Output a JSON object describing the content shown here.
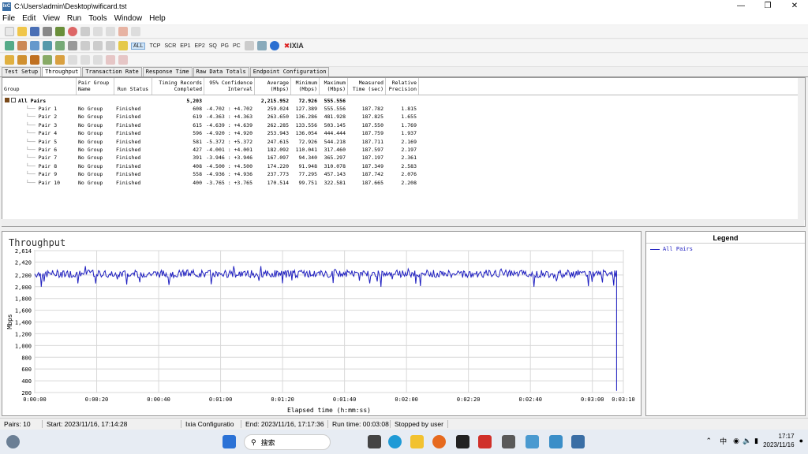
{
  "window": {
    "title": "C:\\Users\\admin\\Desktop\\wificard.tst",
    "app_icon": "IxC"
  },
  "menu": [
    "File",
    "Edit",
    "View",
    "Run",
    "Tools",
    "Window",
    "Help"
  ],
  "toolbar2": {
    "items": [
      "ALL",
      "TCP",
      "SCR",
      "EP1",
      "EP2",
      "SQ",
      "PG",
      "PC"
    ],
    "brand": "IXIA"
  },
  "tabs": [
    "Test Setup",
    "Throughput",
    "Transaction Rate",
    "Response Time",
    "Raw Data Totals",
    "Endpoint Configuration"
  ],
  "grid": {
    "headers": [
      "Group",
      "Pair Group Name",
      "Run Status",
      "Timing Records Completed",
      "95% Confidence Interval",
      "Average (Mbps)",
      "Minimum (Mbps)",
      "Maximum (Mbps)",
      "Measured Time (sec)",
      "Relative Precision"
    ],
    "summary": {
      "label": "All Pairs",
      "records": "5,203",
      "average": "2,215.952",
      "minimum": "72.926",
      "maximum": "555.556"
    },
    "rows": [
      {
        "pair": "Pair 1",
        "group": "No Group",
        "status": "Finished",
        "records": "608",
        "ci": "-4.702 : +4.702",
        "avg": "259.024",
        "min": "127.389",
        "max": "555.556",
        "time": "187.782",
        "prec": "1.815"
      },
      {
        "pair": "Pair 2",
        "group": "No Group",
        "status": "Finished",
        "records": "619",
        "ci": "-4.363 : +4.363",
        "avg": "263.650",
        "min": "136.286",
        "max": "481.928",
        "time": "187.825",
        "prec": "1.655"
      },
      {
        "pair": "Pair 3",
        "group": "No Group",
        "status": "Finished",
        "records": "615",
        "ci": "-4.639 : +4.639",
        "avg": "262.285",
        "min": "133.556",
        "max": "503.145",
        "time": "187.550",
        "prec": "1.769"
      },
      {
        "pair": "Pair 4",
        "group": "No Group",
        "status": "Finished",
        "records": "596",
        "ci": "-4.920 : +4.920",
        "avg": "253.943",
        "min": "136.054",
        "max": "444.444",
        "time": "187.759",
        "prec": "1.937"
      },
      {
        "pair": "Pair 5",
        "group": "No Group",
        "status": "Finished",
        "records": "581",
        "ci": "-5.372 : +5.372",
        "avg": "247.615",
        "min": "72.926",
        "max": "544.218",
        "time": "187.711",
        "prec": "2.169"
      },
      {
        "pair": "Pair 6",
        "group": "No Group",
        "status": "Finished",
        "records": "427",
        "ci": "-4.001 : +4.001",
        "avg": "182.092",
        "min": "110.041",
        "max": "317.460",
        "time": "187.597",
        "prec": "2.197"
      },
      {
        "pair": "Pair 7",
        "group": "No Group",
        "status": "Finished",
        "records": "391",
        "ci": "-3.946 : +3.946",
        "avg": "167.097",
        "min": "94.340",
        "max": "365.297",
        "time": "187.197",
        "prec": "2.361"
      },
      {
        "pair": "Pair 8",
        "group": "No Group",
        "status": "Finished",
        "records": "408",
        "ci": "-4.500 : +4.500",
        "avg": "174.220",
        "min": "91.948",
        "max": "310.078",
        "time": "187.349",
        "prec": "2.583"
      },
      {
        "pair": "Pair 9",
        "group": "No Group",
        "status": "Finished",
        "records": "558",
        "ci": "-4.936 : +4.936",
        "avg": "237.773",
        "min": "77.295",
        "max": "457.143",
        "time": "187.742",
        "prec": "2.076"
      },
      {
        "pair": "Pair 10",
        "group": "No Group",
        "status": "Finished",
        "records": "400",
        "ci": "-3.765 : +3.765",
        "avg": "170.514",
        "min": "99.751",
        "max": "322.581",
        "time": "187.665",
        "prec": "2.208"
      }
    ]
  },
  "chart_data": {
    "type": "line",
    "title": "Throughput",
    "xlabel": "Elapsed time (h:mm:ss)",
    "ylabel": "Mbps",
    "ylim": [
      200,
      2614
    ],
    "yticks": [
      "2,614",
      "2,420",
      "2,200",
      "2,000",
      "1,800",
      "1,600",
      "1,400",
      "1,200",
      "1,000",
      "800",
      "600",
      "400",
      "200"
    ],
    "xticks": [
      "0:00:00",
      "0:00:20",
      "0:00:40",
      "0:01:00",
      "0:01:20",
      "0:01:40",
      "0:02:00",
      "0:02:20",
      "0:02:40",
      "0:03:00",
      "0:03:10"
    ],
    "xlim_sec": [
      0,
      190
    ],
    "series": [
      {
        "name": "All Pairs",
        "color": "#2020c0",
        "mean": 2220,
        "min": 2000,
        "max": 2350,
        "end_time_sec": 187.8,
        "end_value": 230
      }
    ],
    "grid": true,
    "legend_position": "right"
  },
  "legend": {
    "title": "Legend",
    "items": [
      "All Pairs"
    ]
  },
  "status": {
    "pairs": "Pairs: 10",
    "start": "Start: 2023/11/16, 17:14:28",
    "config": "Ixia Configuratio",
    "end": "End: 2023/11/16, 17:17:36",
    "runtime": "Run time: 00:03:08",
    "stopped": "Stopped by user"
  },
  "taskbar": {
    "search": "搜索",
    "ime": "中",
    "time": "17:17",
    "date": "2023/11/16"
  }
}
